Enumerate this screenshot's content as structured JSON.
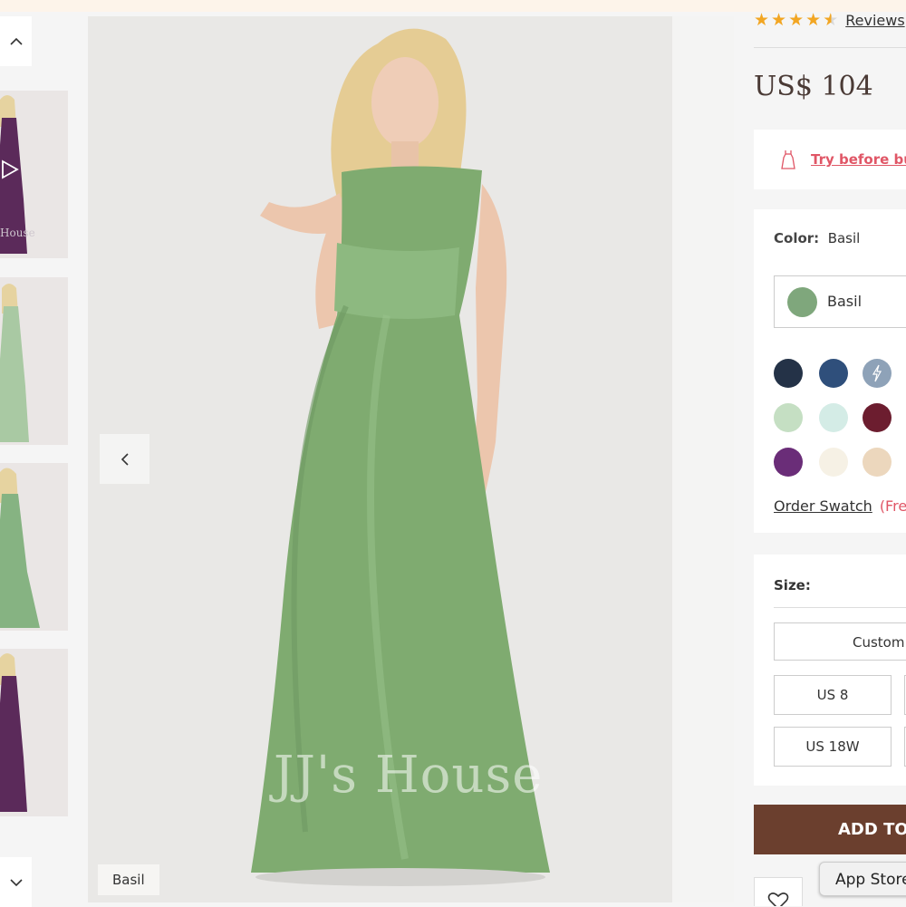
{
  "product": {
    "rating": 4.5,
    "review_label": "Reviews",
    "price": "US$ 104",
    "try_before_buy": "Try before buy",
    "color_label": "Color:",
    "color_value": "Basil",
    "selected_color": "Basil",
    "selected_color_hex": "#7fa77c",
    "order_swatch": "Order Swatch",
    "order_swatch_note": "(Free",
    "size_label": "Size:",
    "sizes": [
      "Custom",
      "US 8",
      "US 18W"
    ],
    "add_to_bag": "ADD TO BAG",
    "app_store": "App Store"
  },
  "gallery": {
    "badge": "D",
    "current_color": "Basil",
    "watermark": "JJ's House",
    "thumb_watermark": "House",
    "thumb_colors": [
      "#5b2a5a",
      "#a9c9a3",
      "#86b382",
      "#5b2a5a"
    ]
  },
  "swatches": [
    "#243247",
    "#2f4f7b",
    "#8ea2b8",
    "#c5dfc3",
    "#d4ece6",
    "#6c1d2f",
    "#6a2d78",
    "#f6f1e5",
    "#ecd7bd"
  ],
  "colors": {
    "brand_brown": "#6b3f2e",
    "accent_pink": "#e05666",
    "star": "#f2a623"
  }
}
